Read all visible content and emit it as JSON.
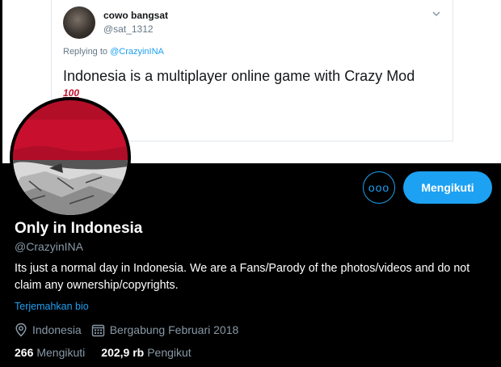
{
  "banner_tweet": {
    "name": "cowo bangsat",
    "handle": "@sat_1312",
    "replying_prefix": "Replying to ",
    "replying_mention": "@CrazyinINA",
    "text": "Indonesia is a multiplayer online game with Crazy Mod",
    "emoji_text": "100"
  },
  "profile": {
    "display_name": "Only in Indonesia",
    "screen_name": "@CrazyinINA",
    "bio": "Its just a normal day in Indonesia. We are a Fans/Parody of the photos/videos and do not claim any ownership/copyrights.",
    "translate_label": "Terjemahkan bio",
    "location": "Indonesia",
    "joined": "Bergabung Februari 2018"
  },
  "actions": {
    "more_label": "ooo",
    "follow_label": "Mengikuti"
  },
  "stats": {
    "following_count": "266",
    "following_label": "Mengikuti",
    "followers_count": "202,9 rb",
    "followers_label": "Pengikut"
  },
  "colors": {
    "accent": "#1da1f2",
    "muted": "#8899a6",
    "background": "#000000",
    "flag_red": "#c8102e"
  },
  "icons": {
    "location": "location-pin-icon",
    "joined": "calendar-icon",
    "chevron": "chevron-down-icon"
  }
}
